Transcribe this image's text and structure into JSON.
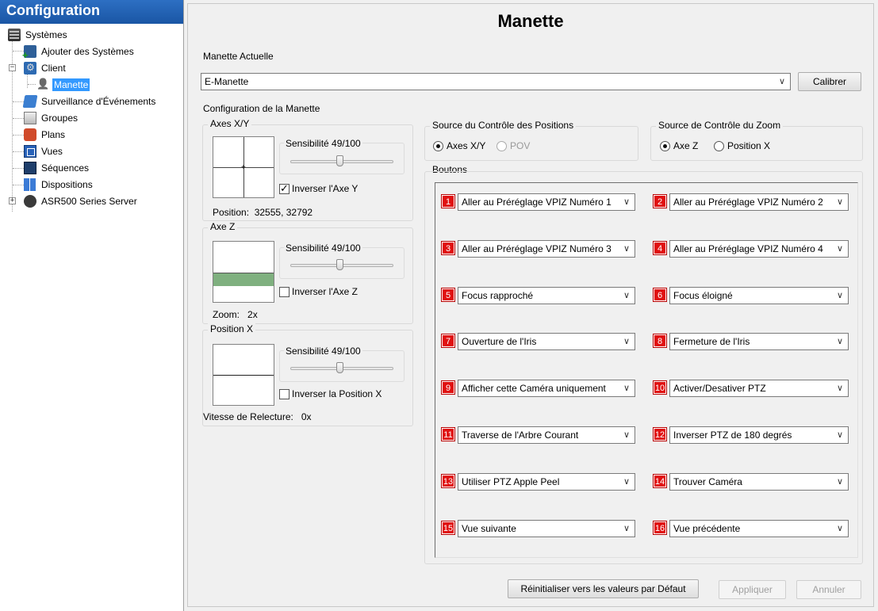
{
  "sidebar": {
    "header": "Configuration",
    "items": [
      {
        "label": "Systèmes"
      },
      {
        "label": "Ajouter des Systèmes"
      },
      {
        "label": "Client"
      },
      {
        "label": "Manette"
      },
      {
        "label": "Surveillance d'Événements"
      },
      {
        "label": "Groupes"
      },
      {
        "label": "Plans"
      },
      {
        "label": "Vues"
      },
      {
        "label": "Séquences"
      },
      {
        "label": "Dispositions"
      },
      {
        "label": "ASR500 Series Server"
      }
    ],
    "selected": "Manette",
    "expander_client": "−",
    "expander_asr": "+"
  },
  "page": {
    "title": "Manette",
    "current_joystick": {
      "legend": "Manette Actuelle",
      "value": "E-Manette",
      "calibrate_label": "Calibrer"
    },
    "config_legend": "Configuration de la Manette",
    "axes_xy": {
      "legend": "Axes X/Y",
      "sensitivity_label": "Sensibilité 49/100",
      "sensitivity": 49,
      "invert_label": "Inverser l'Axe Y",
      "invert_checked": true,
      "position_label": "Position:",
      "position_value": "32555, 32792"
    },
    "axe_z": {
      "legend": "Axe Z",
      "sensitivity_label": "Sensibilité 49/100",
      "sensitivity": 49,
      "invert_label": "Inverser l'Axe Z",
      "invert_checked": false,
      "zoom_label": "Zoom:",
      "zoom_value": "2x"
    },
    "position_x": {
      "legend": "Position X",
      "sensitivity_label": "Sensibilité 49/100",
      "sensitivity": 49,
      "invert_label": "Inverser la Position X",
      "invert_checked": false,
      "speed_label": "Vitesse de Relecture:",
      "speed_value": "0x"
    },
    "position_source": {
      "legend": "Source du Contrôle des Positions",
      "options": [
        {
          "label": "Axes X/Y",
          "selected": true
        },
        {
          "label": "POV",
          "selected": false
        }
      ]
    },
    "zoom_source": {
      "legend": "Source de Contrôle du Zoom",
      "options": [
        {
          "label": "Axe Z",
          "selected": true
        },
        {
          "label": "Position X",
          "selected": false
        }
      ]
    },
    "buttons_legend": "Boutons",
    "buttons": [
      {
        "num": "1",
        "action": "Aller au Préréglage VPIZ Numéro 1"
      },
      {
        "num": "2",
        "action": "Aller au Préréglage VPIZ Numéro 2"
      },
      {
        "num": "3",
        "action": "Aller au Préréglage VPIZ Numéro 3"
      },
      {
        "num": "4",
        "action": "Aller au Préréglage VPIZ Numéro 4"
      },
      {
        "num": "5",
        "action": "Focus rapproché"
      },
      {
        "num": "6",
        "action": "Focus éloigné"
      },
      {
        "num": "7",
        "action": "Ouverture de l'Iris"
      },
      {
        "num": "8",
        "action": "Fermeture de l'Iris"
      },
      {
        "num": "9",
        "action": "Afficher cette Caméra uniquement"
      },
      {
        "num": "10",
        "action": "Activer/Desativer PTZ"
      },
      {
        "num": "11",
        "action": "Traverse de l'Arbre Courant"
      },
      {
        "num": "12",
        "action": "Inverser PTZ de 180 degrés"
      },
      {
        "num": "13",
        "action": "Utiliser PTZ Apple Peel"
      },
      {
        "num": "14",
        "action": "Trouver Caméra"
      },
      {
        "num": "15",
        "action": "Vue suivante"
      },
      {
        "num": "16",
        "action": "Vue précédente"
      }
    ],
    "footer": {
      "reset_label": "Réinitialiser vers les valeurs par Défaut",
      "apply_label": "Appliquer",
      "cancel_label": "Annuler"
    }
  },
  "colors": {
    "accent": "#3399ff",
    "header_blue": "#1a56a5",
    "badge_red": "#e01010",
    "zoom_fill": "#7fb07f"
  }
}
